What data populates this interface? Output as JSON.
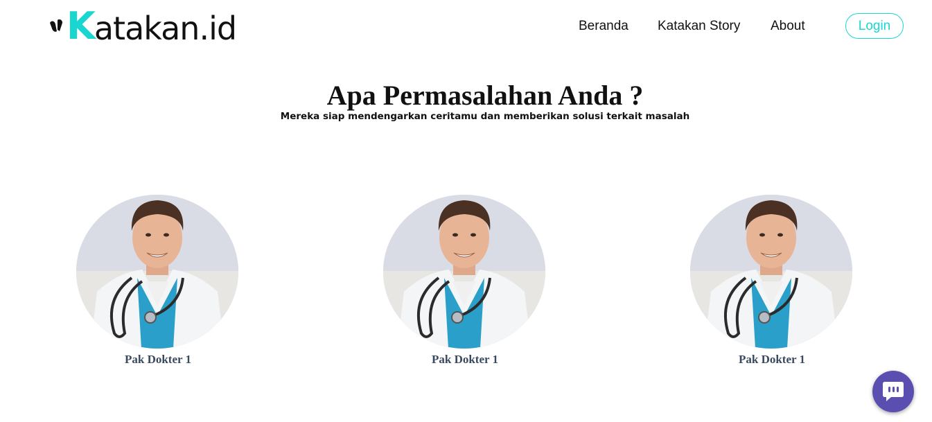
{
  "brand": {
    "logo_k": "K",
    "logo_rest": "atakan.id",
    "accent_color": "#19d7d0",
    "chat_color": "#5a4fb0"
  },
  "nav": {
    "items": [
      {
        "label": "Beranda"
      },
      {
        "label": "Katakan Story"
      },
      {
        "label": "About"
      }
    ],
    "login_label": "Login"
  },
  "hero": {
    "title": "Apa Permasalahan Anda ?",
    "subtitle": "Mereka siap mendengarkan ceritamu dan memberikan solusi terkait masalah"
  },
  "doctors": [
    {
      "name": "Pak Dokter 1",
      "image": "doctor-photo"
    },
    {
      "name": "Pak Dokter 1",
      "image": "doctor-photo"
    },
    {
      "name": "Pak Dokter 1",
      "image": "doctor-photo"
    }
  ],
  "chat_widget": {
    "icon": "chat-bubble-icon"
  }
}
